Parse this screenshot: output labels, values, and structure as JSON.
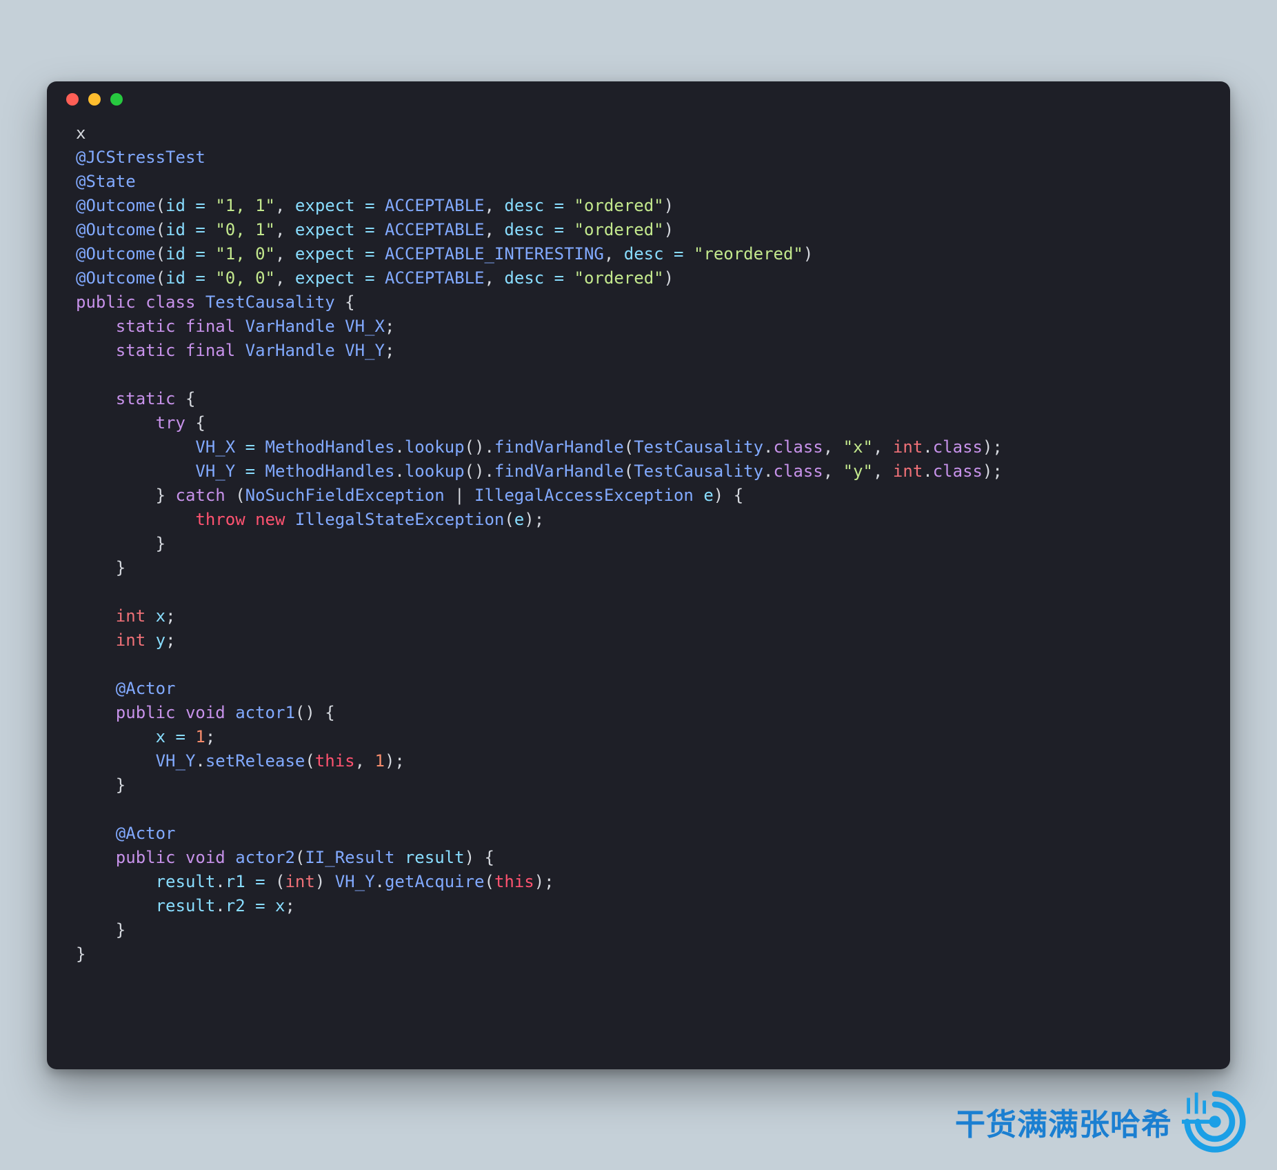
{
  "code": {
    "line1_x": "x",
    "ann_jcstress": "@JCStressTest",
    "ann_state": "@State",
    "outcome1": {
      "ann": "@Outcome",
      "id_key": "id",
      "id_val": "\"1, 1\"",
      "expect_key": "expect",
      "expect_val": "ACCEPTABLE",
      "desc_key": "desc",
      "desc_val": "\"ordered\""
    },
    "outcome2": {
      "ann": "@Outcome",
      "id_key": "id",
      "id_val": "\"0, 1\"",
      "expect_key": "expect",
      "expect_val": "ACCEPTABLE",
      "desc_key": "desc",
      "desc_val": "\"ordered\""
    },
    "outcome3": {
      "ann": "@Outcome",
      "id_key": "id",
      "id_val": "\"1, 0\"",
      "expect_key": "expect",
      "expect_val": "ACCEPTABLE_INTERESTING",
      "desc_key": "desc",
      "desc_val": "\"reordered\""
    },
    "outcome4": {
      "ann": "@Outcome",
      "id_key": "id",
      "id_val": "\"0, 0\"",
      "expect_key": "expect",
      "expect_val": "ACCEPTABLE",
      "desc_key": "desc",
      "desc_val": "\"ordered\""
    },
    "kw_public": "public",
    "kw_class": "class",
    "class_name": "TestCausality",
    "kw_static": "static",
    "kw_final": "final",
    "type_VarHandle": "VarHandle",
    "vh_x": "VH_X",
    "vh_y": "VH_Y",
    "kw_try": "try",
    "method_handles": "MethodHandles",
    "m_lookup": "lookup",
    "m_findVarHandle": "findVarHandle",
    "arg_class": "class",
    "lit_x": "\"x\"",
    "lit_y": "\"y\"",
    "type_int": "int",
    "kw_catch": "catch",
    "exc1": "NoSuchFieldException",
    "exc2": "IllegalAccessException",
    "exc_var": "e",
    "kw_throw": "throw",
    "kw_new": "new",
    "exc_wrap": "IllegalStateException",
    "field_x": "x",
    "field_y": "y",
    "ann_actor": "@Actor",
    "kw_void": "void",
    "m_actor1": "actor1",
    "num_1": "1",
    "m_setRelease": "setRelease",
    "kw_this": "this",
    "m_actor2": "actor2",
    "type_IIResult": "II_Result",
    "param_result": "result",
    "field_r1": "r1",
    "field_r2": "r2",
    "m_getAcquire": "getAcquire"
  },
  "watermark": {
    "text": "干货满满张哈希"
  }
}
